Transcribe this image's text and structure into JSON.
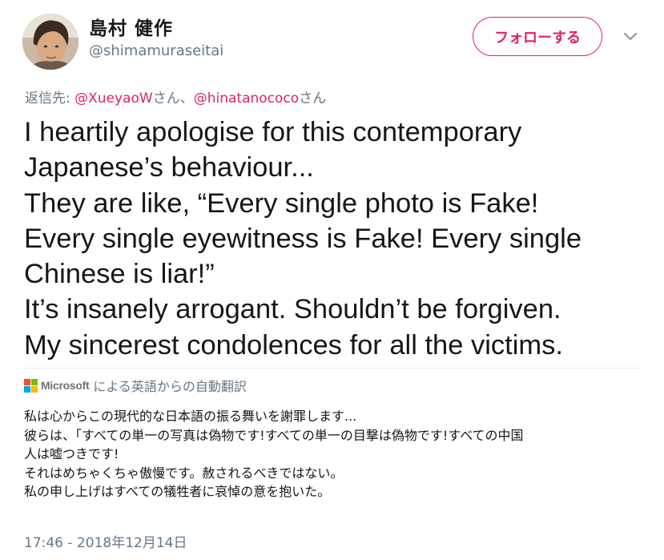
{
  "user": {
    "display_name": "島村 健作",
    "handle": "@shimamuraseitai",
    "avatar_icon": "avatar-photo"
  },
  "follow_button": {
    "label": "フォローする"
  },
  "more_menu": {
    "icon": "chevron-down-icon"
  },
  "reply": {
    "prefix": "返信先: ",
    "mentions": [
      {
        "handle": "@XueyaoW",
        "suffix": "さん、"
      },
      {
        "handle": "@hinatanococo",
        "suffix": "さん"
      }
    ]
  },
  "tweet_lines": [
    "I heartily apologise for this contemporary",
    "Japanese’s behaviour...",
    "They are like, “Every single photo is Fake!",
    "Every single eyewitness is Fake! Every single",
    "Chinese is liar!”",
    "It’s insanely arrogant. Shouldn’t be forgiven.",
    "My sincerest condolences for all the victims."
  ],
  "translation": {
    "provider": "Microsoft",
    "header_suffix": "による英語からの自動翻訳",
    "lines": [
      "私は心からこの現代的な日本語の振る舞いを謝罪します...",
      "彼らは、「すべての単一の写真は偽物です!すべての単一の目撃は偽物です!すべての中国",
      "人は嘘つきです!",
      "それはめちゃくちゃ傲慢です。赦されるべきではない。",
      "私の申し上げはすべての犠牲者に哀悼の意を抱いた。"
    ]
  },
  "timestamp": "17:46 - 2018年12月14日",
  "colors": {
    "accent": "#e0245e",
    "secondary_text": "#657786",
    "primary_text": "#14171a",
    "divider": "#e6ecf0",
    "ms_red": "#f25022",
    "ms_green": "#7fba00",
    "ms_blue": "#00a4ef",
    "ms_yellow": "#ffb900"
  }
}
